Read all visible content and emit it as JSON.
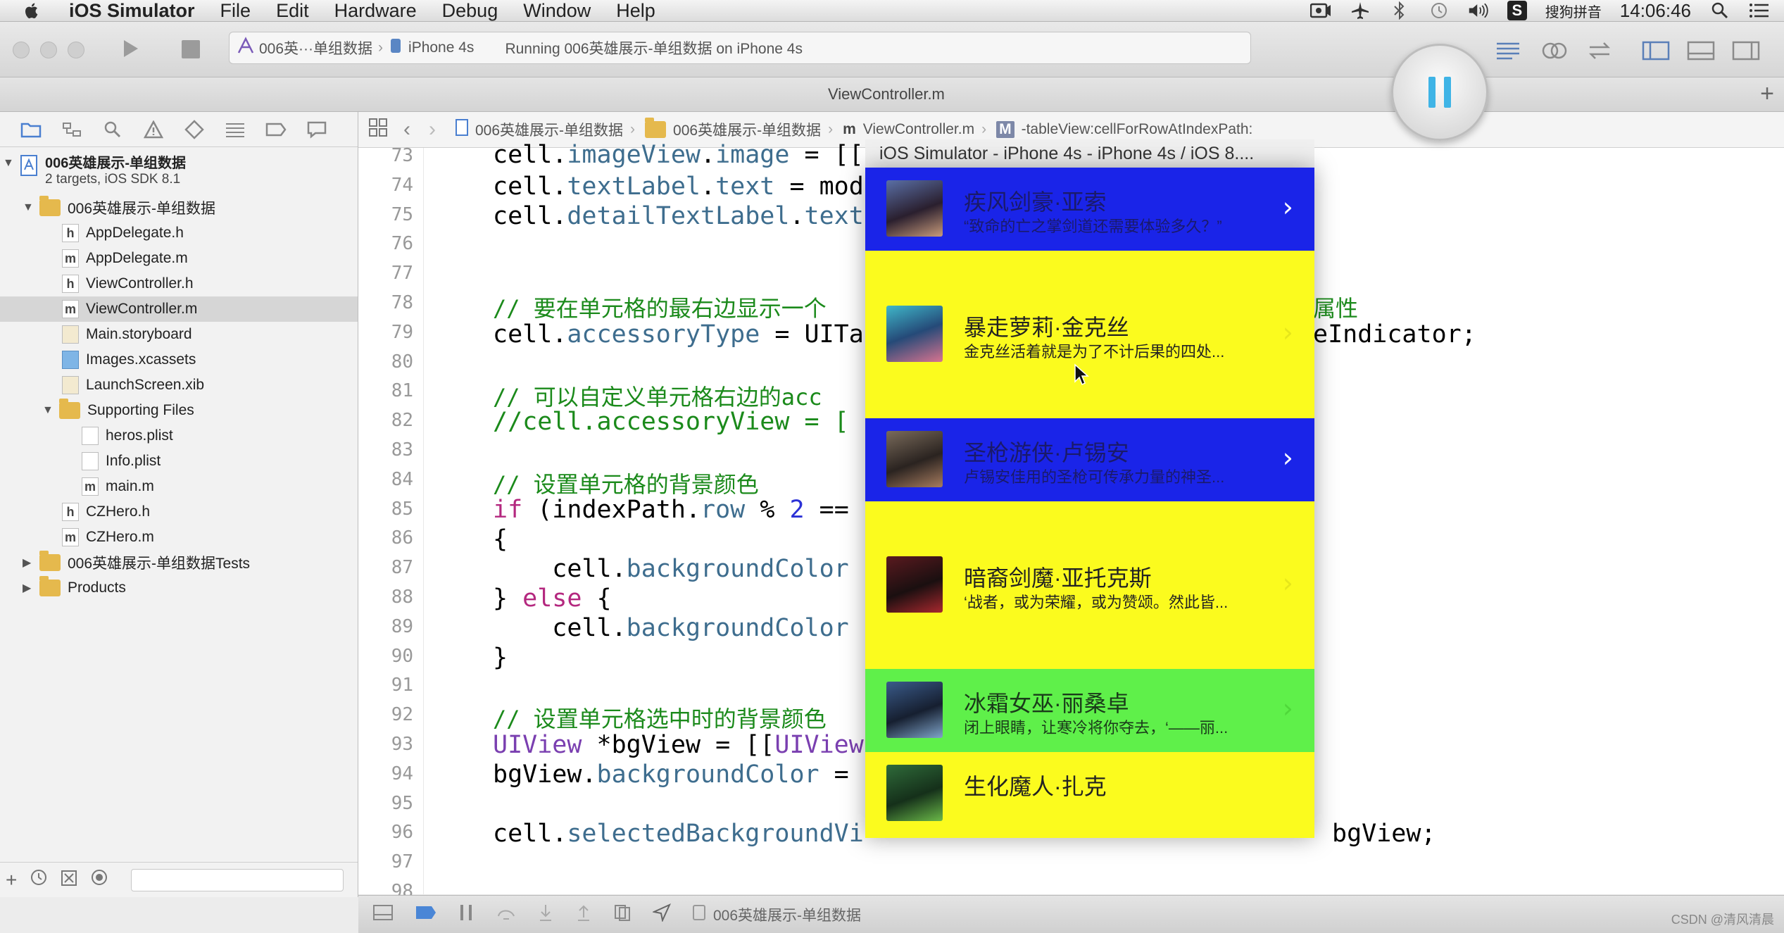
{
  "menubar": {
    "app": "iOS Simulator",
    "items": [
      "File",
      "Edit",
      "Hardware",
      "Debug",
      "Window",
      "Help"
    ],
    "input_method": "搜狗拼音",
    "time": "14:06:46"
  },
  "toolbar": {
    "scheme": "006英···单组数据",
    "device": "iPhone 4s",
    "status": "Running 006英雄展示-单组数据 on iPhone 4s"
  },
  "tab": {
    "title": "ViewController.m"
  },
  "navigator": {
    "project_title": "006英雄展示-单组数据",
    "project_sub": "2 targets, iOS SDK 8.1",
    "group": "006英雄展示-单组数据",
    "files": {
      "appdelegate_h": "AppDelegate.h",
      "appdelegate_m": "AppDelegate.m",
      "viewcontroller_h": "ViewController.h",
      "viewcontroller_m": "ViewController.m",
      "main_storyboard": "Main.storyboard",
      "images": "Images.xcassets",
      "launch": "LaunchScreen.xib",
      "supporting": "Supporting Files",
      "heros": "heros.plist",
      "info": "Info.plist",
      "main_m": "main.m",
      "czhero_h": "CZHero.h",
      "czhero_m": "CZHero.m",
      "tests": "006英雄展示-单组数据Tests",
      "products": "Products"
    },
    "icons": {
      "h": "h",
      "m": "m"
    }
  },
  "jumpbar": {
    "project": "006英雄展示-单组数据",
    "group": "006英雄展示-单组数据",
    "file": "ViewController.m",
    "method": "-tableView:cellForRowAtIndexPath:",
    "m_badge": "m",
    "M_badge": "M"
  },
  "editor": {
    "line_numbers": [
      "73",
      "74",
      "75",
      "76",
      "77",
      "78",
      "79",
      "80",
      "81",
      "82",
      "83",
      "84",
      "85",
      "86",
      "87",
      "88",
      "89",
      "90",
      "91",
      "92",
      "93",
      "94",
      "95",
      "96",
      "97",
      "98"
    ],
    "lines": {
      "l73a": "cell.",
      "l73b": "imageView",
      "l73c": ".",
      "l73d": "image",
      "l73e": " = [[",
      "l74a": "cell.",
      "l74b": "textLabel",
      "l74c": ".",
      "l74d": "text",
      "l74e": " = mod",
      "l75a": "cell.",
      "l75b": "detailTextLabel",
      "l75c": ".",
      "l75d": "text",
      "l78": "// 要在单元格的最右边显示一个",
      "l78r": "属性",
      "l79a": "cell.",
      "l79b": "accessoryType",
      "l79c": " = UITa",
      "l79r": "eIndicator;",
      "l81": "// 可以自定义单元格右边的acc",
      "l82": "//cell.accessoryView = [",
      "l84": "// 设置单元格的背景颜色",
      "l85a": "if",
      "l85b": " (indexPath.",
      "l85c": "row",
      "l85d": " % ",
      "l85e": "2",
      "l85f": " ==",
      "l86": "{",
      "l87a": "    cell.",
      "l87b": "backgroundColor",
      "l88a": "} ",
      "l88b": "else",
      "l88c": " {",
      "l89a": "    cell.",
      "l89b": "backgroundColor",
      "l90": "}",
      "l92": "// 设置单元格选中时的背景颜色",
      "l93a": "UIView",
      "l93b": " *bgView = [[",
      "l93c": "UIView",
      "l94a": "bgView.",
      "l94b": "backgroundColor",
      "l94c": " =",
      "l96a": "cell.",
      "l96b": "selectedBackgroundVi",
      "l96c": "bgView;"
    }
  },
  "debugbar": {
    "target": "006英雄展示-单组数据"
  },
  "simulator": {
    "title": "iOS Simulator - iPhone 4s - iPhone 4s / iOS 8....",
    "cells": [
      {
        "title": "疾风剑豪·亚索",
        "detail": "“致命的亡之掌剑道还需要体验多久？”",
        "bg": "#1a24e8",
        "fg": "#1a1a6a"
      },
      {
        "title": "暴走萝莉·金克丝",
        "detail": "金克丝活着就是为了不计后果的四处...",
        "bg": "#fbfb1e",
        "fg": "#222222"
      },
      {
        "title": "圣枪游侠·卢锡安",
        "detail": "卢锡安佳用的圣枪可传承力量的神圣...",
        "bg": "#1a24e8",
        "fg": "#1a1a6a"
      },
      {
        "title": "暗裔剑魔·亚托克斯",
        "detail": "‘战者，或为荣耀，或为赞颂。然此皆...",
        "bg": "#fbfb1e",
        "fg": "#222222"
      },
      {
        "title": "冰霜女巫·丽桑卓",
        "detail": "闭上眼睛，让寒冷将你夺去，‘——丽...",
        "bg": "#5ff04a",
        "fg": "#1a3a1a"
      },
      {
        "title": "生化魔人·扎克",
        "detail": "",
        "bg": "#fbfb1e",
        "fg": "#222222"
      }
    ]
  },
  "watermark": "CSDN @清风清晨"
}
